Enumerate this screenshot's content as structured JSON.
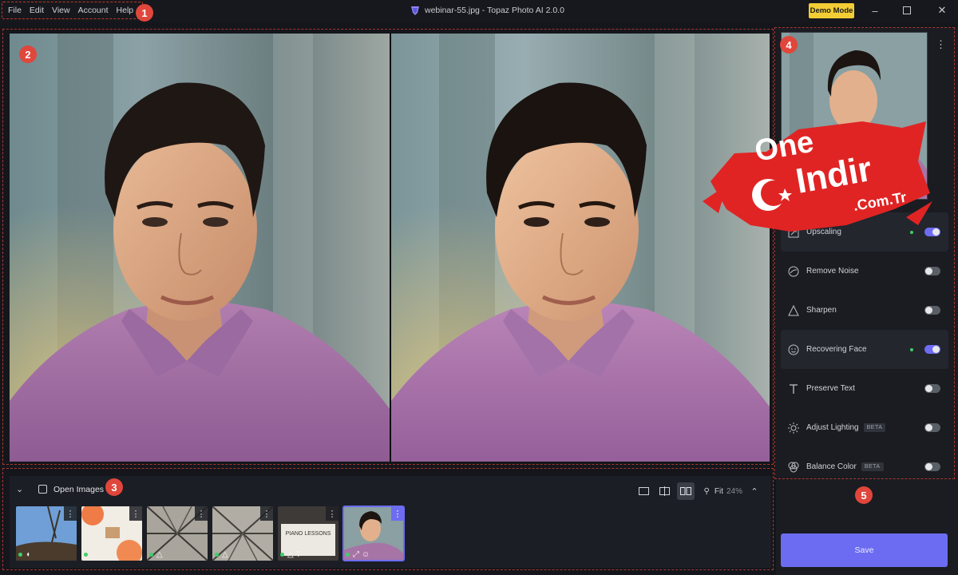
{
  "menu": [
    "File",
    "Edit",
    "View",
    "Account",
    "Help"
  ],
  "window": {
    "title": "webinar-55.jpg - Topaz Photo AI 2.0.0",
    "demo_label": "Demo Mode"
  },
  "markers": [
    "1",
    "2",
    "3",
    "4",
    "5"
  ],
  "strip": {
    "open_label": "Open Images",
    "zoom_label": "Fit",
    "zoom_value": "24%",
    "thumbnails": [
      {
        "name": "sky",
        "badges": [
          "remove-noise-icon"
        ],
        "selected": false
      },
      {
        "name": "oranges",
        "badges": [
          "upscale-icon"
        ],
        "selected": false
      },
      {
        "name": "atrium",
        "badges": [
          "sharpen-icon"
        ],
        "selected": false
      },
      {
        "name": "atrium-2",
        "badges": [
          "sharpen-icon"
        ],
        "selected": false
      },
      {
        "name": "sign",
        "badges": [
          "sharpen-icon",
          "text-icon"
        ],
        "selected": false,
        "sign_text": "PIANO LESSONS"
      },
      {
        "name": "portrait",
        "badges": [
          "upscale-icon",
          "face-icon"
        ],
        "selected": true
      }
    ]
  },
  "tools": [
    {
      "label": "Upscaling",
      "enabled": true,
      "beta": ""
    },
    {
      "label": "Remove Noise",
      "enabled": false,
      "beta": ""
    },
    {
      "label": "Sharpen",
      "enabled": false,
      "beta": ""
    },
    {
      "label": "Recovering Face",
      "enabled": true,
      "beta": ""
    },
    {
      "label": "Preserve Text",
      "enabled": false,
      "beta": ""
    },
    {
      "label": "Adjust Lighting",
      "enabled": false,
      "beta": "BETA"
    },
    {
      "label": "Balance Color",
      "enabled": false,
      "beta": "BETA"
    }
  ],
  "save_label": "Save",
  "watermark": {
    "line1": "One",
    "line2": "Indir",
    "line3": ".Com.Tr"
  },
  "colors": {
    "accent": "#6c6cf2",
    "demo": "#f2cd35",
    "marker": "#e0463c",
    "active_dot": "#3fcf6a"
  }
}
